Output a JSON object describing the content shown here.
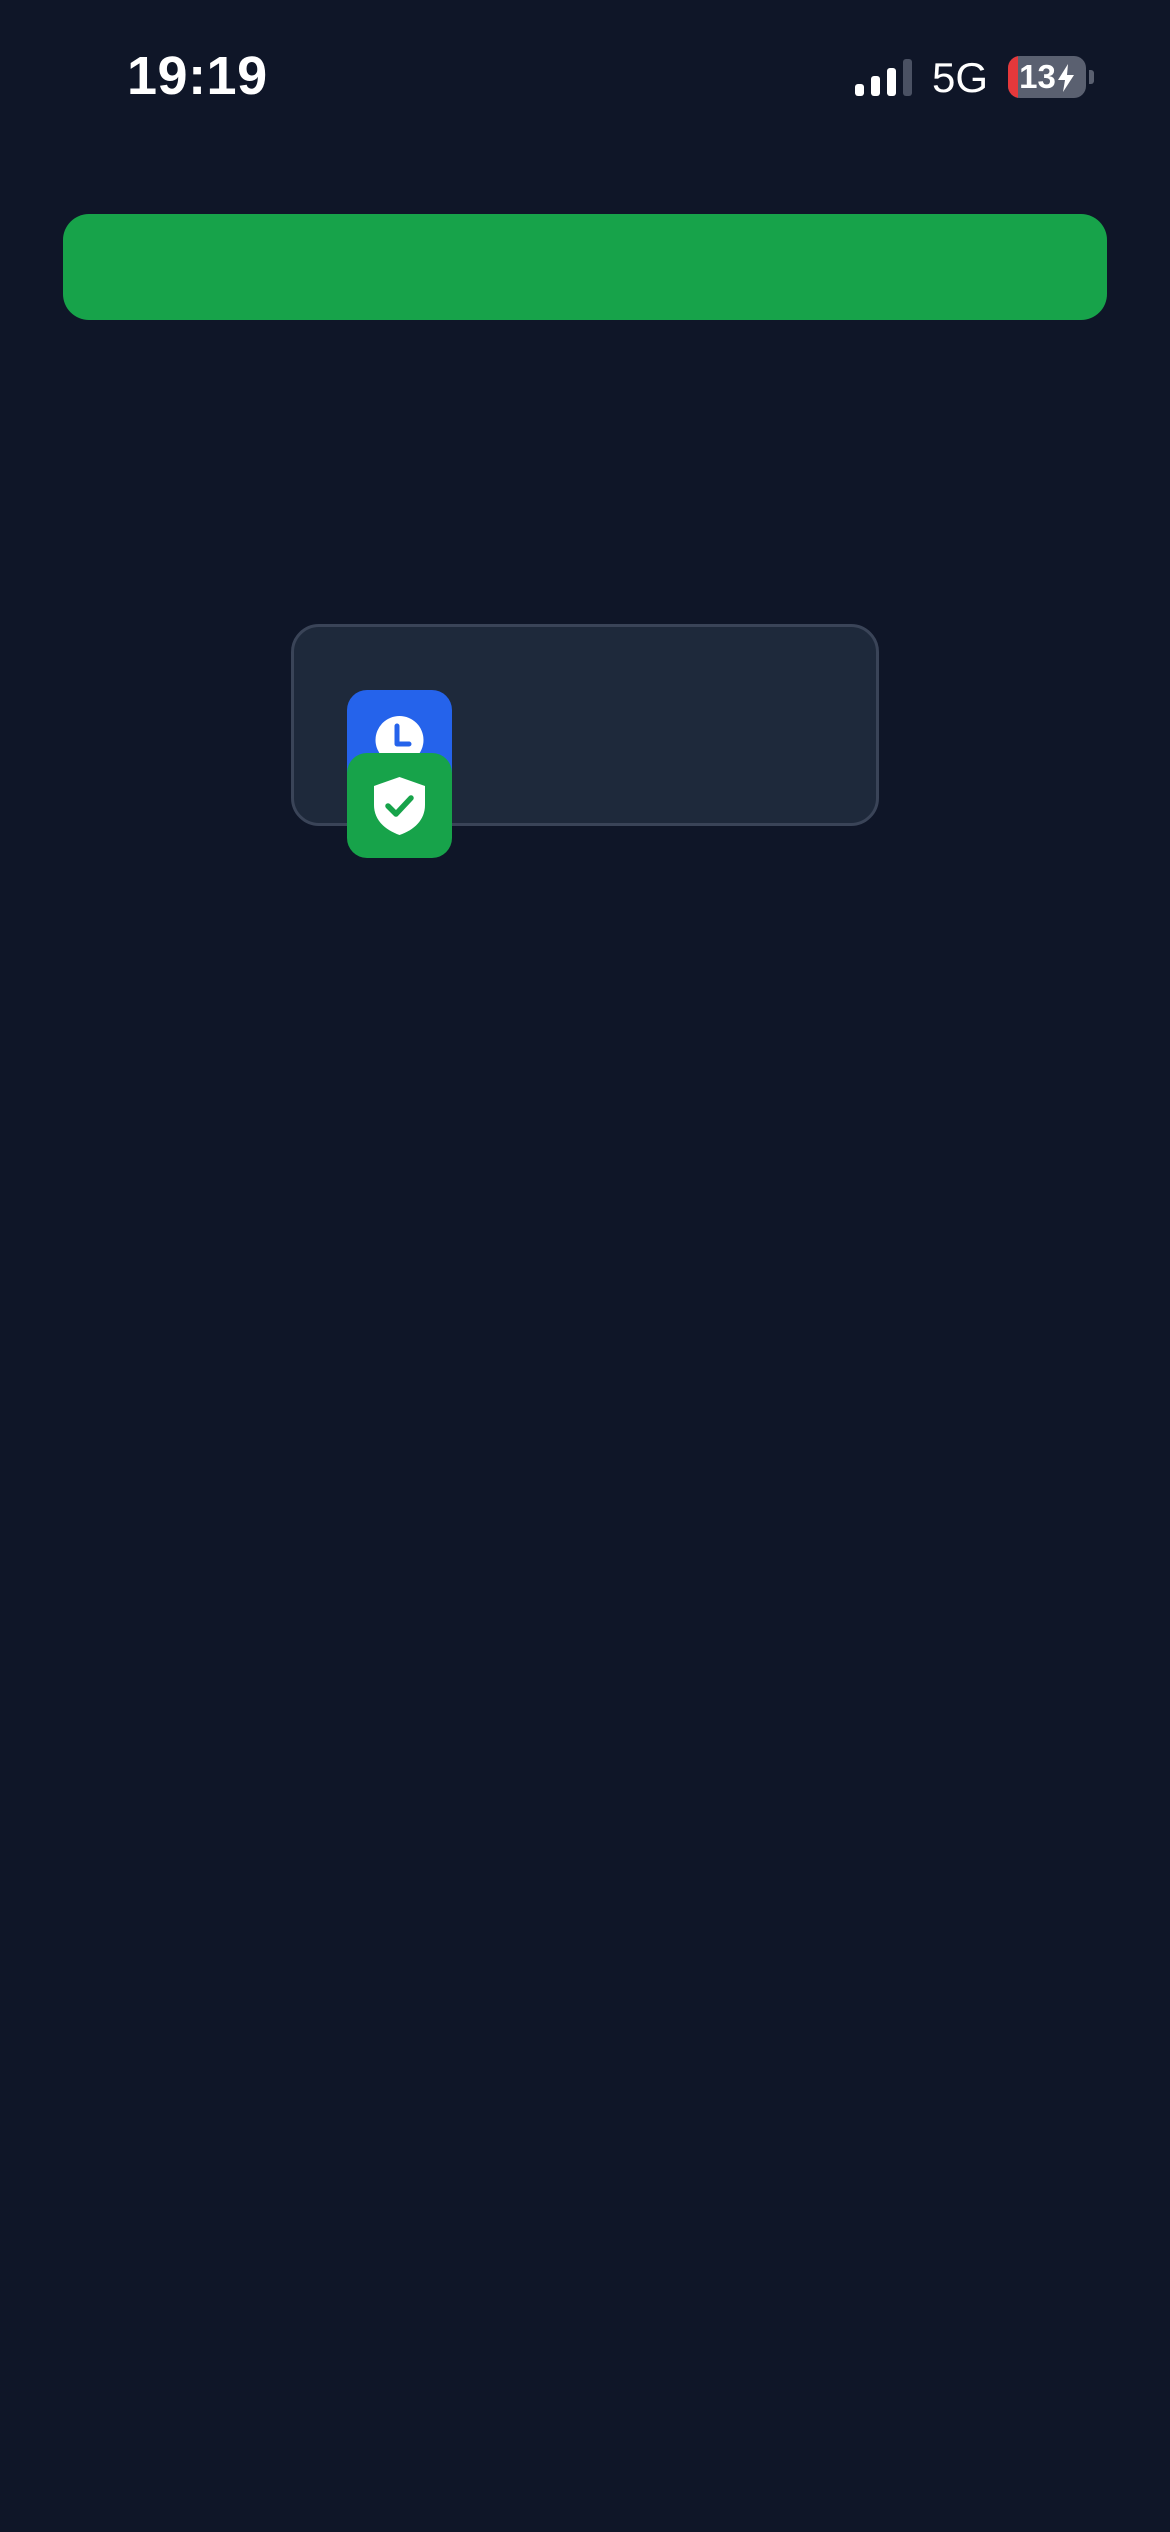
{
  "status_bar": {
    "time": "19:19",
    "network": "5G",
    "battery_level": "13",
    "battery_percent": 13,
    "charging": true,
    "signal_bars_active": 3,
    "signal_bars_total": 4
  },
  "banner": {
    "color": "#17a34a",
    "text": ""
  },
  "card": {
    "icons": [
      {
        "name": "clock-icon",
        "tile_color": "#2563eb"
      },
      {
        "name": "shield-check-icon",
        "tile_color": "#17a34a"
      }
    ]
  },
  "colors": {
    "background": "#0f1628",
    "card_background": "#1e293b",
    "accent_green": "#17a34a",
    "accent_blue": "#2563eb",
    "battery_low": "#e5383b"
  }
}
